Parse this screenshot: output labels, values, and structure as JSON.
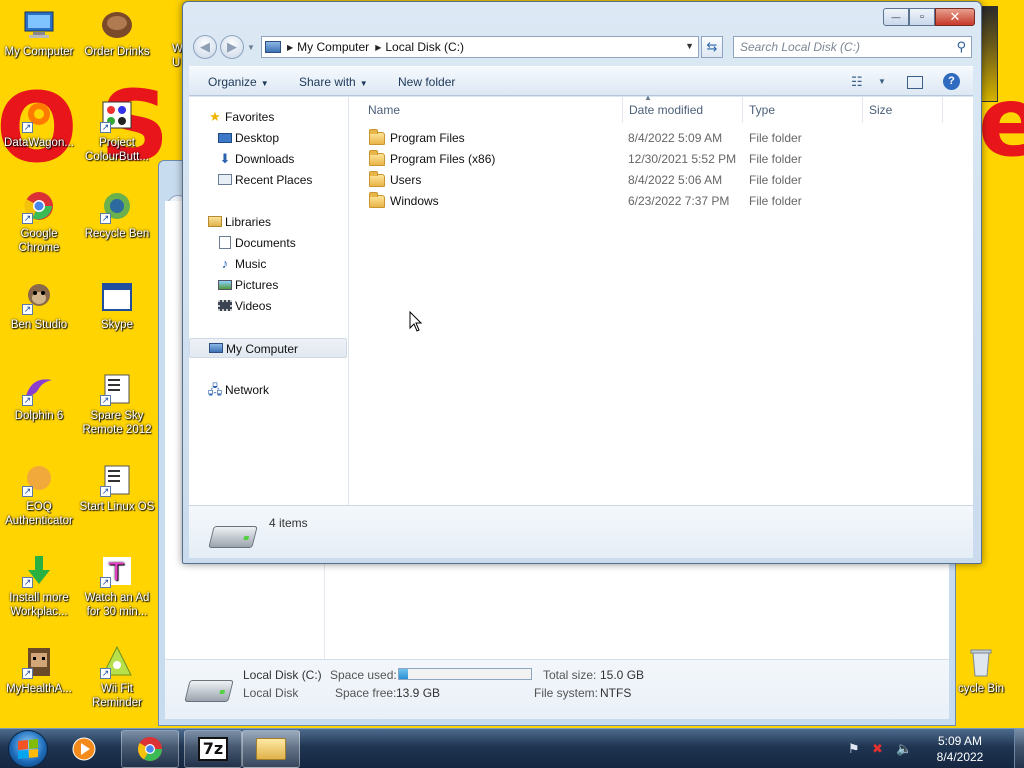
{
  "desktop": {
    "icons": [
      {
        "label": "My Computer",
        "icon": "computer-icon"
      },
      {
        "label": "Order Drinks",
        "icon": "coffee-icon"
      },
      {
        "label": "DataWagon...",
        "icon": "datawagon-icon"
      },
      {
        "label": "Project ColourButt...",
        "icon": "project-icon"
      },
      {
        "label": "Google Chrome",
        "icon": "chrome-icon"
      },
      {
        "label": "Recycle Ben",
        "icon": "recycle-ben-icon"
      },
      {
        "label": "Ben Studio",
        "icon": "ben-studio-icon"
      },
      {
        "label": "Skype",
        "icon": "skype-window-icon"
      },
      {
        "label": "Dolphin 6",
        "icon": "dolphin-icon"
      },
      {
        "label": "Spare Sky Remote 2012",
        "icon": "remote-icon"
      },
      {
        "label": "EOQ Authenticator",
        "icon": "authenticator-icon"
      },
      {
        "label": "Start Linux OS",
        "icon": "linux-icon"
      },
      {
        "label": "Install more Workplac...",
        "icon": "install-icon"
      },
      {
        "label": "Watch an Ad for 30 min...",
        "icon": "ad-icon"
      },
      {
        "label": "MyHealthA...",
        "icon": "health-icon"
      },
      {
        "label": "Wii Fit Reminder",
        "icon": "wiifit-icon"
      }
    ],
    "partial_icons": [
      {
        "label": "W\nU",
        "icon": "partial-icon"
      },
      {
        "label": "cycle Bin",
        "icon": "recycle-bin-icon"
      }
    ],
    "wallpaper_letters": [
      "O",
      "S",
      "e"
    ]
  },
  "background_window": {
    "drive_name": "Local Disk (C:)",
    "drive_type": "Local Disk",
    "space_used_label": "Space used:",
    "space_used_fraction": 0.07,
    "space_free_label": "Space free:",
    "space_free_value": "13.9 GB",
    "total_size_label": "Total size:",
    "total_size_value": "15.0 GB",
    "file_system_label": "File system:",
    "file_system_value": "NTFS"
  },
  "explorer": {
    "caption": {
      "minimize": "—",
      "maximize": "▫",
      "close": "✕"
    },
    "breadcrumb": [
      "My Computer",
      "Local Disk (C:)"
    ],
    "search_placeholder": "Search Local Disk (C:)",
    "toolbar": {
      "organize": "Organize",
      "share_with": "Share with",
      "new_folder": "New folder"
    },
    "nav": {
      "favorites": "Favorites",
      "desktop": "Desktop",
      "downloads": "Downloads",
      "recent_places": "Recent Places",
      "libraries": "Libraries",
      "documents": "Documents",
      "music": "Music",
      "pictures": "Pictures",
      "videos": "Videos",
      "my_computer": "My Computer",
      "network": "Network"
    },
    "columns": {
      "name": "Name",
      "date_modified": "Date modified",
      "type": "Type",
      "size": "Size"
    },
    "files": [
      {
        "name": "Program Files",
        "date": "8/4/2022 5:09 AM",
        "type": "File folder"
      },
      {
        "name": "Program Files (x86)",
        "date": "12/30/2021 5:52 PM",
        "type": "File folder"
      },
      {
        "name": "Users",
        "date": "8/4/2022 5:06 AM",
        "type": "File folder"
      },
      {
        "name": "Windows",
        "date": "6/23/2022 7:37 PM",
        "type": "File folder"
      }
    ],
    "status": {
      "item_count": "4 items"
    }
  },
  "taskbar": {
    "buttons": [
      "media-player-icon",
      "chrome-icon",
      "7zip-icon",
      "explorer-folder-icon"
    ],
    "zip_label": "7z",
    "clock": {
      "time": "5:09 AM",
      "date": "8/4/2022"
    }
  },
  "colors": {
    "wallpaper": "#ffd400",
    "wallpaper_text": "#e8151a",
    "taskbar": "#1f3552",
    "folder": "#e8b548"
  }
}
